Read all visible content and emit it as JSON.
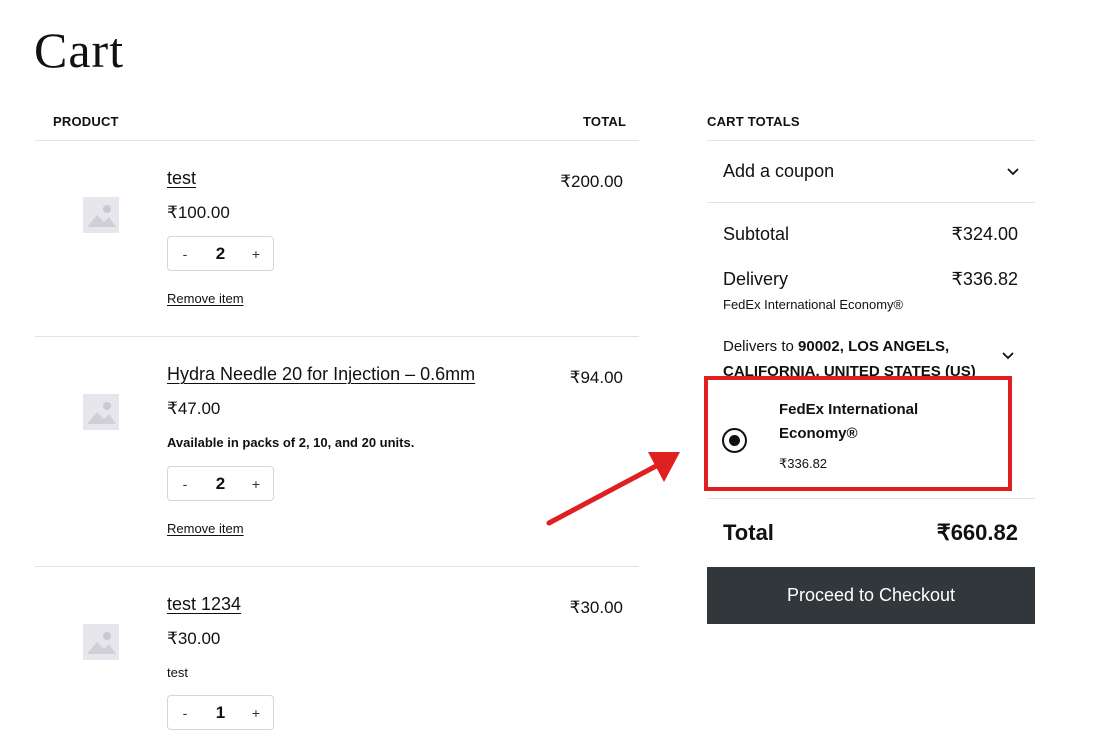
{
  "page": {
    "title": "Cart"
  },
  "table": {
    "col_product": "PRODUCT",
    "col_total": "TOTAL"
  },
  "items": [
    {
      "name": "test",
      "price": "₹100.00",
      "note": "",
      "qty": "2",
      "total": "₹200.00",
      "remove": "Remove item",
      "minus": "-",
      "plus": "+"
    },
    {
      "name": "Hydra Needle 20 for Injection – 0.6mm",
      "price": "₹47.00",
      "note": "Available in packs of 2, 10, and 20 units.",
      "qty": "2",
      "total": "₹94.00",
      "remove": "Remove item",
      "minus": "-",
      "plus": "+"
    },
    {
      "name": "test 1234",
      "price": "₹30.00",
      "note": "test",
      "qty": "1",
      "total": "₹30.00",
      "minus": "-",
      "plus": "+"
    }
  ],
  "totals": {
    "heading": "CART TOTALS",
    "coupon_label": "Add a coupon",
    "subtotal_label": "Subtotal",
    "subtotal_value": "₹324.00",
    "delivery_label": "Delivery",
    "delivery_value": "₹336.82",
    "delivery_method": "FedEx International Economy®",
    "delivers_to_prefix": "Delivers to",
    "delivers_to_address": "90002, LOS ANGELS, CALIFORNIA, UNITED STATES (US)",
    "shipping_option_name": "FedEx International Economy®",
    "shipping_option_price": "₹336.82",
    "total_label": "Total",
    "total_value": "₹660.82",
    "checkout_label": "Proceed to Checkout"
  },
  "colors": {
    "highlight": "#e02020",
    "button_bg": "#32373c",
    "divider": "#e2e2e2"
  },
  "icons": {
    "placeholder": "image-placeholder-icon",
    "chevron": "chevron-down-icon",
    "radio": "radio-selected-icon",
    "arrow": "annotation-arrow-icon"
  }
}
